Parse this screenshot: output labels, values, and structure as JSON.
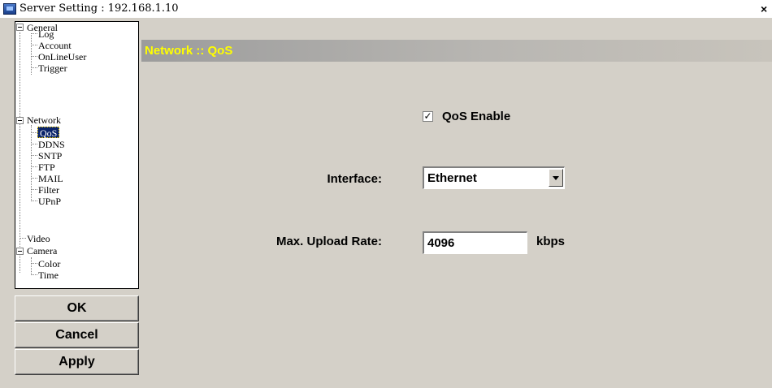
{
  "window": {
    "title": "Server Setting : 192.168.1.10",
    "close_symbol": "×",
    "icon": "app-window-icon"
  },
  "tree": {
    "nodes": [
      {
        "label": "General",
        "level": 0,
        "expanded": true
      },
      {
        "label": "Log",
        "level": 1
      },
      {
        "label": "Account",
        "level": 1
      },
      {
        "label": "OnLineUser",
        "level": 1
      },
      {
        "label": "Trigger",
        "level": 1
      },
      {
        "label": "Network",
        "level": 0,
        "expanded": true
      },
      {
        "label": "QoS",
        "level": 1,
        "selected": true
      },
      {
        "label": "DDNS",
        "level": 1
      },
      {
        "label": "SNTP",
        "level": 1
      },
      {
        "label": "FTP",
        "level": 1
      },
      {
        "label": "MAIL",
        "level": 1
      },
      {
        "label": "Filter",
        "level": 1
      },
      {
        "label": "UPnP",
        "level": 1
      },
      {
        "label": "Video",
        "level": 0
      },
      {
        "label": "Camera",
        "level": 0,
        "expanded": true
      },
      {
        "label": "Color",
        "level": 1
      },
      {
        "label": "Time",
        "level": 1
      }
    ]
  },
  "buttons": {
    "ok": "OK",
    "cancel": "Cancel",
    "apply": "Apply"
  },
  "panel": {
    "header": "Network :: QoS",
    "qos_enable": {
      "label": "QoS Enable",
      "checked": true,
      "check_mark": "✓"
    },
    "interface": {
      "label": "Interface:",
      "value": "Ethernet"
    },
    "upload": {
      "label": "Max. Upload Rate:",
      "value": "4096",
      "unit": "kbps"
    }
  },
  "colors": {
    "header_text": "#ffff00",
    "selection": "#0a246a",
    "face": "#d4d0c8"
  }
}
